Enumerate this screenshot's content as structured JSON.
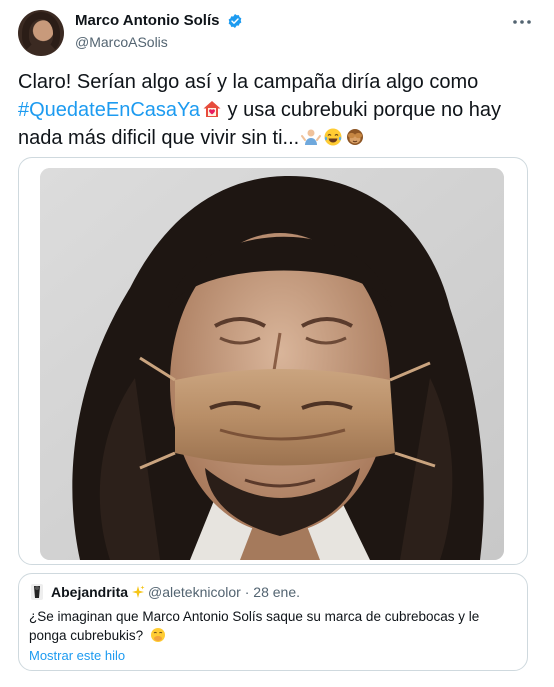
{
  "author": {
    "display_name": "Marco Antonio Solís",
    "handle": "@MarcoASolis",
    "verified": true
  },
  "tweet": {
    "text_before": "Claro! Serían algo así y la campaña diría algo como ",
    "hashtag": "#QuedateEnCasaYa",
    "text_after": " y usa cubrebuki porque no hay nada más dificil que vivir sin ti...",
    "emojis": [
      "house-with-heart-icon",
      "person-shrugging-icon",
      "tears-of-joy-icon",
      "see-no-evil-monkey-icon"
    ]
  },
  "media": {
    "icon": "photo-of-man-with-long-hair-and-face-mask"
  },
  "quoted_tweet": {
    "display_name": "Abejandrita",
    "handle": "@aleteknicolor",
    "separator": "·",
    "date": "28 ene.",
    "text": "¿Se imaginan que Marco Antonio Solís saque su marca de cubrebocas y le ponga cubrebukis?",
    "show_thread": "Mostrar este hilo"
  },
  "colors": {
    "link": "#1d9bf0",
    "verified": "#1d9bf0",
    "secondary_text": "#536471",
    "border": "#cfd9de"
  }
}
